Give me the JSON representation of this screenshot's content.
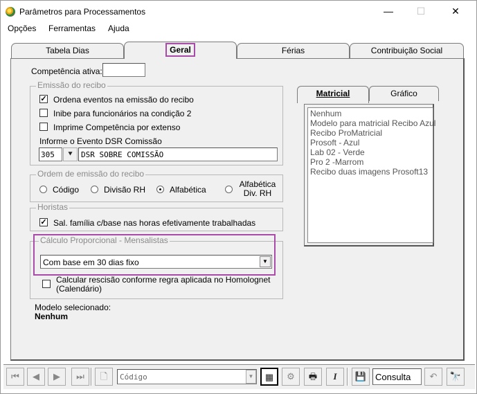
{
  "window": {
    "title": "Parâmetros para Processamentos",
    "minimize": "—",
    "maximize": "☐",
    "close": "✕"
  },
  "menu": [
    "Opções",
    "Ferramentas",
    "Ajuda"
  ],
  "tabs": [
    "Tabela Dias",
    "Geral",
    "Férias",
    "Contribuição Social"
  ],
  "active_tab": "Geral",
  "competencia": {
    "label": "Competência ativa:",
    "value": ""
  },
  "emissao": {
    "title": "Emissão do recibo",
    "options": [
      {
        "label": "Ordena eventos na emissão do recibo",
        "checked": true
      },
      {
        "label": "Inibe para funcionários na condição 2",
        "checked": false
      },
      {
        "label": "Imprime Competência por extenso",
        "checked": false
      }
    ],
    "dsr_label": "Informe o Evento DSR Comissão",
    "dsr_code": "305",
    "dsr_desc": "DSR SOBRE COMISSÃO"
  },
  "ordem": {
    "title": "Ordem de emissão do recibo",
    "options": [
      "Código",
      "Divisão RH",
      "Alfabética",
      "Alfabética Div.  RH"
    ],
    "selected": "Alfabética"
  },
  "horistas": {
    "title": "Horistas",
    "option": {
      "label": "Sal. família c/base nas horas efetivamente trabalhadas",
      "checked": true
    }
  },
  "calculo": {
    "title": "Cálculo Proporcional - Mensalistas",
    "selected": "Com base em 30 dias fixo",
    "rescisao_label_1": "Calcular rescisão conforme regra aplicada no Homolognet",
    "rescisao_label_2": "(Calendário)",
    "rescisao_checked": false
  },
  "modelo": {
    "label": "Modelo selecionado:",
    "value": "Nenhum"
  },
  "subtabs": [
    "Matricial",
    "Gráfico"
  ],
  "active_subtab": "Matricial",
  "modelos_list": [
    "Nenhum",
    "Modelo para matricial Recibo Azul",
    "Recibo ProMatricial",
    "Prosoft - Azul",
    "Lab 02 - Verde",
    "Pro 2 -Marrom",
    "Recibo duas imagens Prosoft13"
  ],
  "toolbar": {
    "code_placeholder": "Código",
    "consulta": "Consulta"
  },
  "icons": {
    "first": "⏮",
    "prev": "◀",
    "next": "▶",
    "last": "⏭",
    "new": "🗋",
    "dropdown": "▼",
    "printer": "🖶",
    "italic": "I",
    "save": "💾",
    "undo": "↶",
    "binoculars": "🔭"
  }
}
